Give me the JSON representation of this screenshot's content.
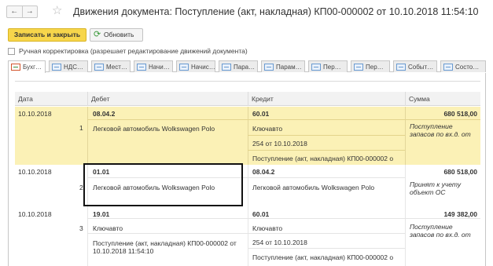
{
  "window": {
    "title": "Движения документа: Поступление (акт, накладная) КП00-000002 от 10.10.2018 11:54:10",
    "back_glyph": "←",
    "forward_glyph": "→",
    "star_glyph": "☆",
    "icons": [
      "back-arrow-icon",
      "forward-arrow-icon",
      "star-icon",
      "refresh-icon"
    ]
  },
  "toolbar": {
    "save_close_label": "Записать и закрыть",
    "refresh_label": "Обновить",
    "refresh_glyph": "⟳"
  },
  "manual": {
    "label": "Ручная корректировка (разрешает редактирование движений документа)",
    "checked": false
  },
  "tabs": [
    {
      "label": "Бухг…"
    },
    {
      "label": "НДС…"
    },
    {
      "label": "Мест…"
    },
    {
      "label": "Начи…"
    },
    {
      "label": "Начис…"
    },
    {
      "label": "Пара…"
    },
    {
      "label": "Парам…"
    },
    {
      "label": "Пер…"
    },
    {
      "label": "Пер…"
    },
    {
      "label": "Событ…"
    },
    {
      "label": "Состо…"
    }
  ],
  "columns": {
    "date": "Дата",
    "debit": "Дебет",
    "credit": "Кредит",
    "sum": "Сумма"
  },
  "rows": [
    {
      "date": "10.10.2018",
      "num": "1",
      "debit_account": "08.04.2",
      "debit_sub1": "Легковой автомобиль Wolkswagen Polo",
      "credit_account": "60.01",
      "credit_sub1": "Ключавто",
      "credit_sub2": "254 от 10.10.2018",
      "credit_sub3": "Поступление (акт, накладная) КП00-000002 о",
      "amount": "680 518,00",
      "description": "Поступление запасов по вх.д. от"
    },
    {
      "date": "10.10.2018",
      "num": "2",
      "debit_account": "01.01",
      "debit_sub1": "Легковой автомобиль Wolkswagen Polo",
      "credit_account": "08.04.2",
      "credit_sub1": "Легковой автомобиль Wolkswagen Polo",
      "amount": "680 518,00",
      "description": "Принят к учету объект ОС"
    },
    {
      "date": "10.10.2018",
      "num": "3",
      "debit_account": "19.01",
      "debit_sub1": "Ключавто",
      "debit_sub2a": "Поступление (акт, накладная) КП00-000002 от",
      "debit_sub2b": "10.10.2018 11:54:10",
      "credit_account": "60.01",
      "credit_sub1": "Ключавто",
      "credit_sub2": "254 от 10.10.2018",
      "credit_sub3": "Поступление (акт, накладная) КП00-000002 о",
      "amount": "149 382,00",
      "description": "Поступление запасов по вх.д. от"
    }
  ],
  "colors": {
    "selected_row": "#fbf1b6",
    "primary_button": "#f7d64b"
  }
}
